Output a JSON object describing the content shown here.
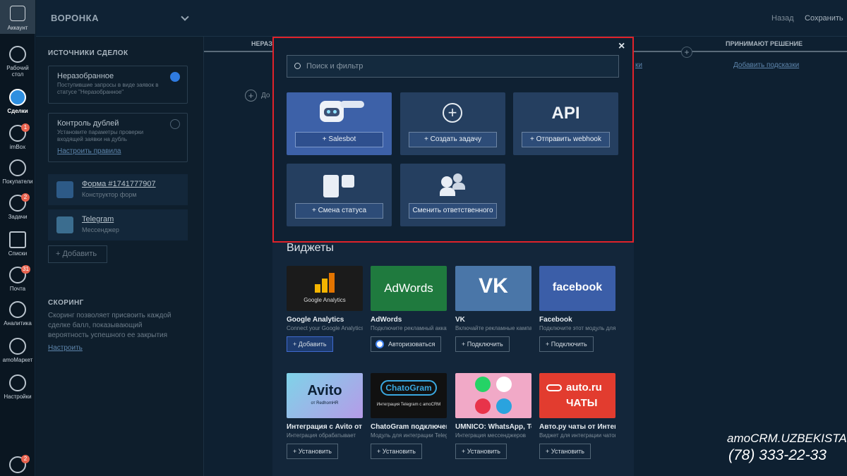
{
  "rail": {
    "account": "Аккаунт",
    "items": [
      {
        "label": "Рабочий стол",
        "icon": "dashboard-icon"
      },
      {
        "label": "Сделки",
        "icon": "deals-icon",
        "active": true
      },
      {
        "label": "imBox",
        "icon": "chat-icon",
        "badge": "1"
      },
      {
        "label": "Покупатели",
        "icon": "customers-icon"
      },
      {
        "label": "Задачи",
        "icon": "tasks-icon",
        "badge": "2"
      },
      {
        "label": "Списки",
        "icon": "lists-icon"
      },
      {
        "label": "Почта",
        "icon": "mail-icon",
        "badge": "31"
      },
      {
        "label": "Аналитика",
        "icon": "analytics-icon"
      },
      {
        "label": "amoМаркет",
        "icon": "market-icon"
      },
      {
        "label": "Настройки",
        "icon": "settings-icon"
      }
    ],
    "bottom_badge": "2"
  },
  "header": {
    "title": "ВОРОНКА",
    "back": "Назад",
    "save": "Сохранить"
  },
  "sources": {
    "title": "ИСТОЧНИКИ СДЕЛОК",
    "unsorted": {
      "title": "Неразобранное",
      "desc": "Поступившие запросы в виде заявок в статусе \"Неразобранное\""
    },
    "dupes": {
      "title": "Контроль дублей",
      "desc": "Установите параметры проверки входящей заявки на дубль",
      "link": "Настроить правила"
    },
    "items": [
      {
        "title": "Форма #1741777907",
        "sub": "Конструктор форм"
      },
      {
        "title": "Telegram",
        "sub": "Мессенджер"
      }
    ],
    "add": "+ Добавить"
  },
  "scoring": {
    "title": "СКОРИНГ",
    "desc": "Скоринг позволяет присвоить каждой сделке балл, показывающий вероятность успешного ее закрытия",
    "link": "Настроить"
  },
  "columns": {
    "first": "НЕРАЗ",
    "last": "ПРИНИМАЮТ РЕШЕНИЕ",
    "hint_left": "ки",
    "hint_right": "Добавить подсказки",
    "add_stub": "До"
  },
  "modal": {
    "close": "×",
    "search_placeholder": "Поиск и фильтр",
    "actions": [
      {
        "label": "+ Salesbot",
        "icon": "bot-icon"
      },
      {
        "label": "+ Создать задачу",
        "icon": "plus-circle-icon"
      },
      {
        "label": "+ Отправить webhook",
        "icon": "api-icon",
        "icon_text": "API"
      },
      {
        "label": "+ Смена статуса",
        "icon": "status-change-icon"
      },
      {
        "label": "Сменить ответственного",
        "icon": "responsible-icon"
      }
    ],
    "widgets_title": "Виджеты",
    "widgets": [
      {
        "name": "Google Analytics",
        "desc": "Connect your Google Analytics",
        "button": "+ Добавить",
        "logo": "Google Analytics",
        "bg": "#1b1b1b",
        "primary": true
      },
      {
        "name": "AdWords",
        "desc": "Подключите рекламный аккаунт",
        "button": "Авторизоваться",
        "logo": "AdWords",
        "bg": "#1f7a3e"
      },
      {
        "name": "VK",
        "desc": "Включайте рекламные кампании",
        "button": "+ Подключить",
        "logo": "VK",
        "bg": "#4a76a8"
      },
      {
        "name": "Facebook",
        "desc": "Подключите этот модуль для",
        "button": "+ Подключить",
        "logo": "facebook",
        "bg": "#3b5ea8"
      },
      {
        "name": "Интеграция с Avito от R",
        "desc": "Интеграция обрабатывает",
        "button": "+ Установить",
        "logo": "Avito",
        "logo_sub": "от RedhomHR",
        "bg": "#6cc0e0"
      },
      {
        "name": "ChatoGram подключение",
        "desc": "Модуль для интеграции Telegram",
        "button": "+ Установить",
        "logo": "ChatoGram",
        "logo_sub": "Интеграция Telegram с amoCRM",
        "bg": "#111111"
      },
      {
        "name": "UMNICO: WhatsApp, Teleg",
        "desc": "Интеграция мессенджеров",
        "button": "+ Установить",
        "logo": "",
        "bg": "#f1a9c7"
      },
      {
        "name": "Авто.ру чаты от Интеграц",
        "desc": "Виджет для интеграции чатов",
        "button": "+ Установить",
        "logo": "auto.ru",
        "logo_sub": "ЧАТЫ",
        "bg": "#e23c2f"
      }
    ]
  },
  "brand": {
    "line1": "amoCRM.UZBEKISTAN",
    "line2": "(78) 333-22-33"
  }
}
